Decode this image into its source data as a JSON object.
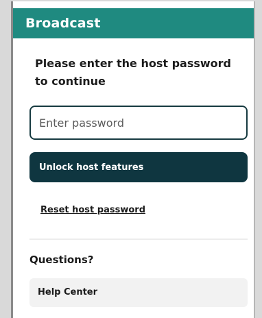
{
  "header": {
    "title": "Broadcast"
  },
  "prompt": {
    "text": "Please enter the host password to continue"
  },
  "password": {
    "placeholder": "Enter password",
    "value": ""
  },
  "unlock": {
    "label": "Unlock host features"
  },
  "reset": {
    "label": "Reset host password"
  },
  "questions": {
    "heading": "Questions?",
    "help_label": "Help Center"
  },
  "colors": {
    "header_bg": "#1f8a80",
    "button_bg": "#0f3640",
    "input_border": "#163a40"
  }
}
